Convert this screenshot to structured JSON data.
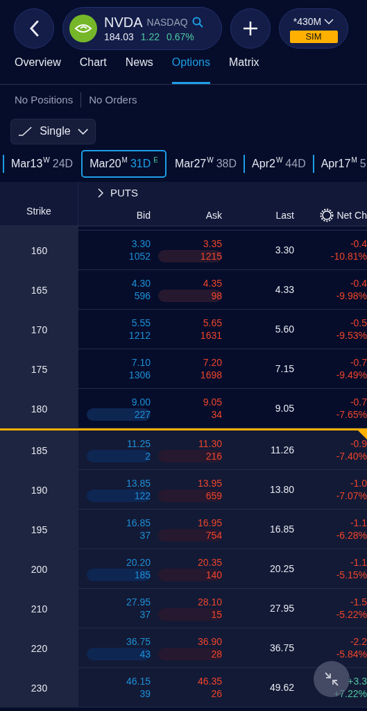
{
  "header": {
    "symbol": "NVDA",
    "exchange": "NASDAQ",
    "price": "184.03",
    "change": "1.22",
    "change_pct": "0.67%",
    "account": "*430M",
    "account_mode": "SIM"
  },
  "tabs": [
    {
      "label": "Overview",
      "selected": false
    },
    {
      "label": "Chart",
      "selected": false
    },
    {
      "label": "News",
      "selected": false
    },
    {
      "label": "Options",
      "selected": true
    },
    {
      "label": "Matrix",
      "selected": false
    }
  ],
  "summary": [
    "No Positions",
    "No Orders"
  ],
  "strategy": "Single",
  "expirations": [
    {
      "date": "Mar13",
      "type": "W",
      "days": "24D",
      "selected": false
    },
    {
      "date": "Mar20",
      "type": "M",
      "days": "31D",
      "earnings": "E",
      "selected": true
    },
    {
      "date": "Mar27",
      "type": "W",
      "days": "38D",
      "selected": false
    },
    {
      "date": "Apr2",
      "type": "W",
      "days": "44D",
      "selected": false
    },
    {
      "date": "Apr17",
      "type": "M",
      "days": "5",
      "selected": false
    }
  ],
  "section": "PUTS",
  "columns": [
    "Strike",
    "Bid",
    "Ask",
    "Last",
    "Net Ch"
  ],
  "rows": [
    {
      "strike": "160",
      "bid": "3.30",
      "bid_size": "1052",
      "bid_bar": false,
      "ask": "3.35",
      "ask_size": "1215",
      "ask_bar": true,
      "last": "3.30",
      "net_chg": "-0.4",
      "net_pct": "-10.81%",
      "in_the_money": false
    },
    {
      "strike": "165",
      "bid": "4.30",
      "bid_size": "596",
      "bid_bar": false,
      "ask": "4.35",
      "ask_size": "98",
      "ask_bar": true,
      "last": "4.33",
      "net_chg": "-0.4",
      "net_pct": "-9.98%",
      "in_the_money": false
    },
    {
      "strike": "170",
      "bid": "5.55",
      "bid_size": "1212",
      "bid_bar": false,
      "ask": "5.65",
      "ask_size": "1631",
      "ask_bar": false,
      "last": "5.60",
      "net_chg": "-0.5",
      "net_pct": "-9.53%",
      "in_the_money": false
    },
    {
      "strike": "175",
      "bid": "7.10",
      "bid_size": "1306",
      "bid_bar": false,
      "ask": "7.20",
      "ask_size": "1698",
      "ask_bar": false,
      "last": "7.15",
      "net_chg": "-0.7",
      "net_pct": "-9.49%",
      "in_the_money": false
    },
    {
      "strike": "180",
      "bid": "9.00",
      "bid_size": "227",
      "bid_bar": true,
      "ask": "9.05",
      "ask_size": "34",
      "ask_bar": false,
      "last": "9.05",
      "net_chg": "-0.7",
      "net_pct": "-7.65%",
      "in_the_money": false
    },
    {
      "strike": "185",
      "bid": "11.25",
      "bid_size": "2",
      "bid_bar": true,
      "ask": "11.30",
      "ask_size": "216",
      "ask_bar": true,
      "last": "11.26",
      "net_chg": "-0.9",
      "net_pct": "-7.40%",
      "in_the_money": true
    },
    {
      "strike": "190",
      "bid": "13.85",
      "bid_size": "122",
      "bid_bar": true,
      "ask": "13.95",
      "ask_size": "659",
      "ask_bar": true,
      "last": "13.80",
      "net_chg": "-1.0",
      "net_pct": "-7.07%",
      "in_the_money": true
    },
    {
      "strike": "195",
      "bid": "16.85",
      "bid_size": "37",
      "bid_bar": false,
      "ask": "16.95",
      "ask_size": "754",
      "ask_bar": true,
      "last": "16.85",
      "net_chg": "-1.1",
      "net_pct": "-6.28%",
      "in_the_money": true
    },
    {
      "strike": "200",
      "bid": "20.20",
      "bid_size": "185",
      "bid_bar": true,
      "ask": "20.35",
      "ask_size": "140",
      "ask_bar": true,
      "last": "20.25",
      "net_chg": "-1.1",
      "net_pct": "-5.15%",
      "in_the_money": true
    },
    {
      "strike": "210",
      "bid": "27.95",
      "bid_size": "37",
      "bid_bar": false,
      "ask": "28.10",
      "ask_size": "15",
      "ask_bar": true,
      "last": "27.95",
      "net_chg": "-1.5",
      "net_pct": "-5.22%",
      "in_the_money": true
    },
    {
      "strike": "220",
      "bid": "36.75",
      "bid_size": "43",
      "bid_bar": true,
      "ask": "36.90",
      "ask_size": "28",
      "ask_bar": true,
      "last": "36.75",
      "net_chg": "-2.2",
      "net_pct": "-5.84%",
      "in_the_money": true
    },
    {
      "strike": "230",
      "bid": "46.15",
      "bid_size": "39",
      "bid_bar": false,
      "ask": "46.35",
      "ask_size": "26",
      "ask_bar": false,
      "last": "49.62",
      "net_chg": "+3.3",
      "net_pct": "+7.22%",
      "in_the_money": true
    }
  ]
}
